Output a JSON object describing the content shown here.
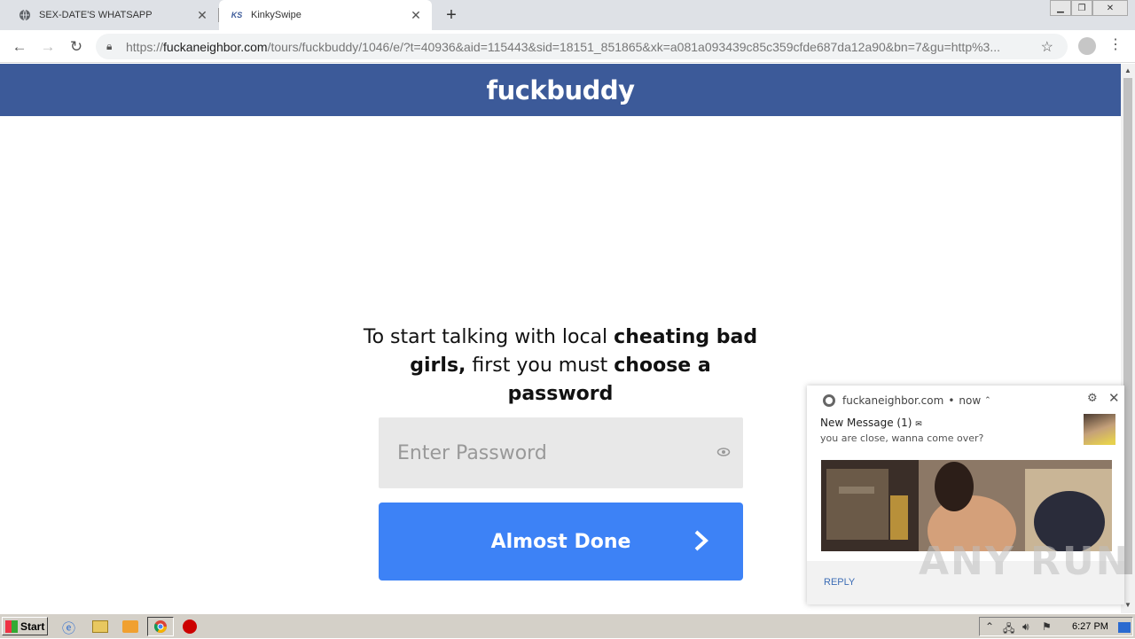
{
  "browser": {
    "tabs": [
      {
        "title": "SEX-DATE'S WHATSAPP",
        "favicon": "globe-icon",
        "active": false
      },
      {
        "title": "KinkySwipe",
        "favicon": "KS",
        "active": true
      }
    ],
    "new_tab": "+",
    "url_host": "fuckaneighbor.com",
    "url_prefix": "https://",
    "url_path": "/tours/fuckbuddy/1046/e/?t=40936&aid=115443&sid=18151_851865&xk=a081a093439c85c359cfde687da12a90&bn=7&gu=http%3..."
  },
  "page": {
    "brand": "fuckbuddy",
    "brand_color": "#3c5a99",
    "headline": {
      "p1": "To start talking with local ",
      "b1": "cheating bad girls,",
      "p2": " first you must ",
      "b2": "choose a password"
    },
    "password_placeholder": "Enter Password",
    "cta_label": "Almost Done",
    "cta_color": "#3d82f6"
  },
  "notification": {
    "source": "fuckaneighbor.com",
    "time": "now",
    "title": "New Message (1)",
    "body": "you are close, wanna come over?",
    "reply_label": "REPLY"
  },
  "watermark": "ANY RUN",
  "taskbar": {
    "start_label": "Start",
    "clock": "6:27 PM"
  }
}
